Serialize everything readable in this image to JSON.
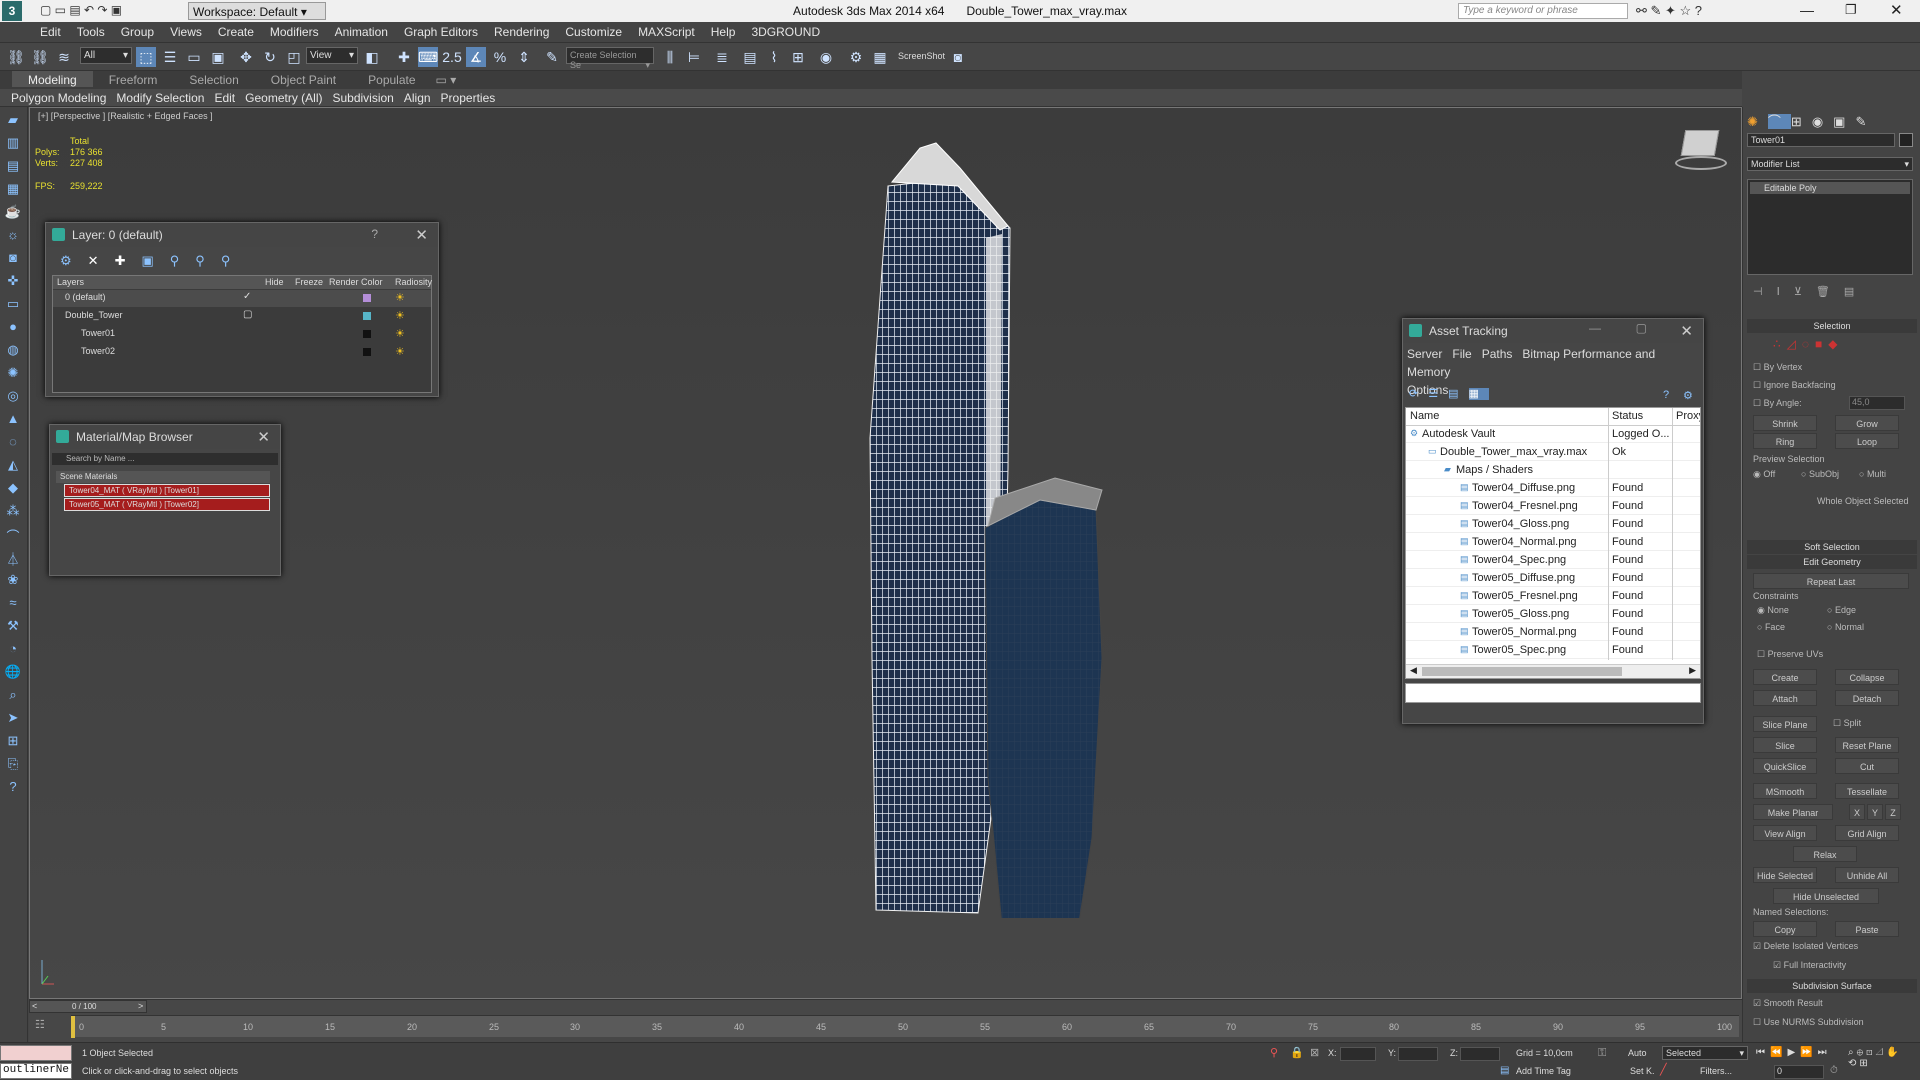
{
  "titlebar": {
    "workspace": "Workspace: Default",
    "app": "Autodesk 3ds Max  2014 x64",
    "file": "Double_Tower_max_vray.max",
    "search_placeholder": "Type a keyword or phrase"
  },
  "menu": [
    "Edit",
    "Tools",
    "Group",
    "Views",
    "Create",
    "Modifiers",
    "Animation",
    "Graph Editors",
    "Rendering",
    "Customize",
    "MAXScript",
    "Help",
    "3DGROUND"
  ],
  "toolbar": {
    "selection_filter": "All",
    "ref_coord": "View",
    "named_set": "Create Selection Se",
    "screenshot": "ScreenShot"
  },
  "ribbon_tabs": [
    "Modeling",
    "Freeform",
    "Selection",
    "Object Paint",
    "Populate"
  ],
  "ribbon_items": [
    "Polygon Modeling",
    "Modify Selection",
    "Edit",
    "Geometry (All)",
    "Subdivision",
    "Align",
    "Properties"
  ],
  "viewport": {
    "label": "[+] [Perspective ] [Realistic + Edged Faces ]",
    "total": "Total",
    "polys_label": "Polys:",
    "polys": "176 366",
    "verts_label": "Verts:",
    "verts": "227 408",
    "fps_label": "FPS:",
    "fps": "259,222"
  },
  "layer_dialog": {
    "title": "Layer: 0 (default)",
    "headers": [
      "Layers",
      "Hide",
      "Freeze",
      "Render",
      "Color",
      "Radiosity"
    ],
    "rows": [
      {
        "name": "0 (default)",
        "color": "#b48ed8"
      },
      {
        "name": "Double_Tower",
        "color": "#57b5c8"
      },
      {
        "name": "Tower01",
        "color": "#111111"
      },
      {
        "name": "Tower02",
        "color": "#111111"
      }
    ]
  },
  "material_browser": {
    "title": "Material/Map Browser",
    "search": "Search by Name ...",
    "group": "Scene Materials",
    "items": [
      "Tower04_MAT ( VRayMtl ) [Tower01]",
      "Tower05_MAT ( VRayMtl ) [Tower02]"
    ]
  },
  "asset_tracking": {
    "title": "Asset Tracking",
    "menu": [
      "Server",
      "File",
      "Paths",
      "Bitmap Performance and Memory",
      "Options"
    ],
    "headers": [
      "Name",
      "Status",
      "Proxy"
    ],
    "rows": [
      {
        "name": "Autodesk Vault",
        "status": "Logged O..."
      },
      {
        "name": "Double_Tower_max_vray.max",
        "status": "Ok"
      },
      {
        "name": "Maps / Shaders",
        "status": ""
      },
      {
        "name": "Tower04_Diffuse.png",
        "status": "Found"
      },
      {
        "name": "Tower04_Fresnel.png",
        "status": "Found"
      },
      {
        "name": "Tower04_Gloss.png",
        "status": "Found"
      },
      {
        "name": "Tower04_Normal.png",
        "status": "Found"
      },
      {
        "name": "Tower04_Spec.png",
        "status": "Found"
      },
      {
        "name": "Tower05_Diffuse.png",
        "status": "Found"
      },
      {
        "name": "Tower05_Fresnel.png",
        "status": "Found"
      },
      {
        "name": "Tower05_Gloss.png",
        "status": "Found"
      },
      {
        "name": "Tower05_Normal.png",
        "status": "Found"
      },
      {
        "name": "Tower05_Spec.png",
        "status": "Found"
      }
    ]
  },
  "command_panel": {
    "object_name": "Tower01",
    "modifier_list": "Modifier List",
    "stack_item": "Editable Poly",
    "selection": "Selection",
    "by_vertex": "By Vertex",
    "ignore_backfacing": "Ignore Backfacing",
    "by_angle": "By Angle:",
    "angle_value": "45,0",
    "shrink": "Shrink",
    "grow": "Grow",
    "ring": "Ring",
    "loop": "Loop",
    "preview_selection": "Preview Selection",
    "off": "Off",
    "subobj": "SubObj",
    "multi": "Multi",
    "whole_object": "Whole Object Selected",
    "soft_selection": "Soft Selection",
    "edit_geometry": "Edit Geometry",
    "repeat_last": "Repeat Last",
    "constraints": "Constraints",
    "none": "None",
    "edge": "Edge",
    "face": "Face",
    "normal": "Normal",
    "preserve_uvs": "Preserve UVs",
    "create": "Create",
    "collapse": "Collapse",
    "attach": "Attach",
    "detach": "Detach",
    "slice_plane": "Slice Plane",
    "split": "Split",
    "slice": "Slice",
    "reset_plane": "Reset Plane",
    "quickslice": "QuickSlice",
    "cut": "Cut",
    "msmooth": "MSmooth",
    "tessellate": "Tessellate",
    "make_planar": "Make Planar",
    "x": "X",
    "y": "Y",
    "z": "Z",
    "view_align": "View Align",
    "grid_align": "Grid Align",
    "relax": "Relax",
    "hide_selected": "Hide Selected",
    "unhide_all": "Unhide All",
    "hide_unselected": "Hide Unselected",
    "named_selections": "Named Selections:",
    "copy": "Copy",
    "paste": "Paste",
    "delete_isolated": "Delete Isolated Vertices",
    "full_interactivity": "Full Interactivity",
    "subdivision_surface": "Subdivision Surface",
    "smooth_result": "Smooth Result",
    "use_nurms": "Use NURMS Subdivision"
  },
  "timeline": {
    "frame": "0 / 100",
    "ticks": [
      "0",
      "5",
      "10",
      "15",
      "20",
      "25",
      "30",
      "35",
      "40",
      "45",
      "50",
      "55",
      "60",
      "65",
      "70",
      "75",
      "80",
      "85",
      "90",
      "95",
      "100"
    ]
  },
  "status": {
    "script": "outlinerNe",
    "selected": "1 Object Selected",
    "prompt": "Click or click-and-drag to select objects",
    "x": "X:",
    "y": "Y:",
    "z": "Z:",
    "grid": "Grid = 10,0cm",
    "auto": "Auto",
    "set_key": "Set K.",
    "selected_dd": "Selected",
    "filters": "Filters...",
    "add_time_tag": "Add Time Tag",
    "frame_field": "0"
  }
}
